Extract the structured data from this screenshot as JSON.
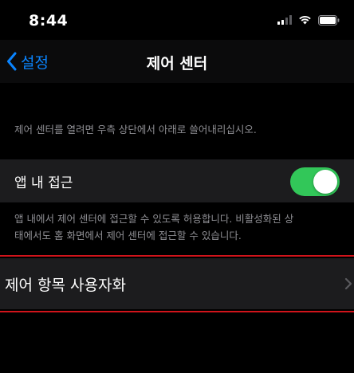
{
  "status_bar": {
    "time": "8:44",
    "icons": [
      "cellular-signal-icon",
      "wifi-icon",
      "battery-icon"
    ]
  },
  "nav": {
    "back_label": "설정",
    "title": "제어 센터"
  },
  "section": {
    "header": "제어 센터를 열려면 우측 상단에서 아래로 쓸어내리십시오.",
    "app_access": {
      "label": "앱 내 접근",
      "toggle_on": true
    },
    "footer_line1": "앱 내에서 제어 센터에 접근할 수 있도록 허용합니다. 비활성화된 상",
    "footer_line2": "태에서도 홈 화면에서 제어 센터에 접근할 수 있습니다."
  },
  "customize": {
    "label": "제어 항목 사용자화"
  },
  "colors": {
    "accent": "#0a84ff",
    "toggle_on": "#32c759",
    "highlight": "#d1141b"
  }
}
